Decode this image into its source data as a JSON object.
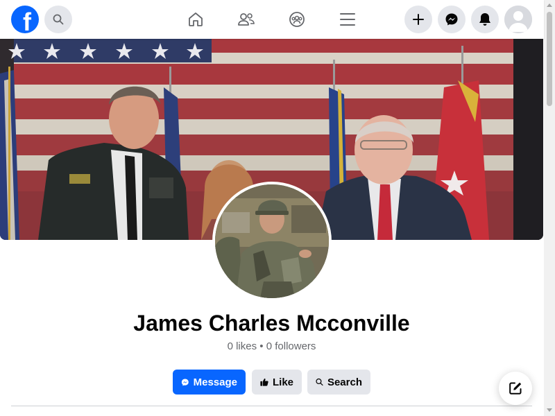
{
  "brand": {
    "logo_letter": "f",
    "accent": "#0866ff"
  },
  "nav": {
    "icons": [
      "search-icon",
      "home-icon",
      "friends-icon",
      "groups-icon",
      "menu-icon",
      "plus-icon",
      "messenger-icon",
      "bell-icon",
      "avatar"
    ]
  },
  "profile": {
    "name": "James Charles Mcconville",
    "likes": "0 likes",
    "separator": "•",
    "followers": "0 followers"
  },
  "actions": {
    "message_label": "Message",
    "like_label": "Like",
    "search_label": "Search"
  },
  "colors": {
    "primary": "#0866ff",
    "secondary_bg": "#e4e6eb",
    "muted_text": "#65676b"
  }
}
